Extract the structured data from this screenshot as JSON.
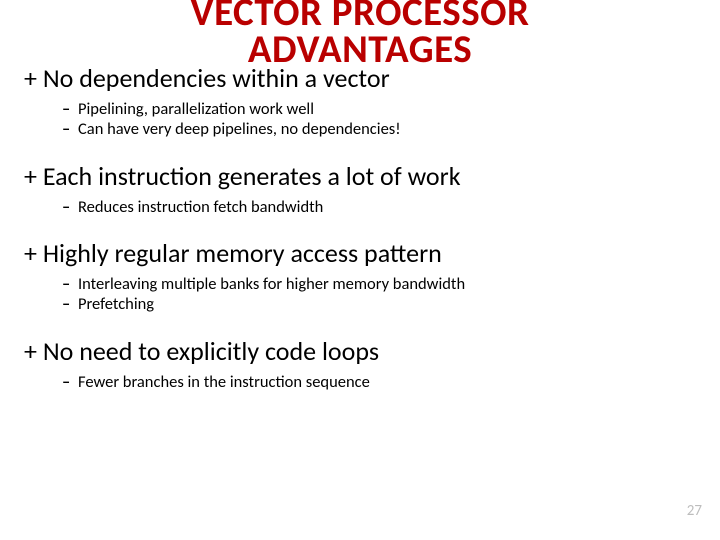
{
  "title_line1": "VECTOR PROCESSOR",
  "title_line2": "ADVANTAGES",
  "points": [
    {
      "heading": "+ No dependencies within a vector",
      "subs": [
        "Pipelining, parallelization work well",
        "Can have very deep pipelines, no dependencies!"
      ]
    },
    {
      "heading": "+ Each instruction generates a lot of work",
      "subs": [
        "Reduces instruction fetch bandwidth"
      ]
    },
    {
      "heading": "+ Highly regular memory access pattern",
      "subs": [
        "Interleaving multiple banks for higher memory bandwidth",
        "Prefetching"
      ]
    },
    {
      "heading": "+ No need to explicitly code loops",
      "subs": [
        "Fewer branches in the instruction sequence"
      ]
    }
  ],
  "page_number": "27",
  "dash": "–"
}
